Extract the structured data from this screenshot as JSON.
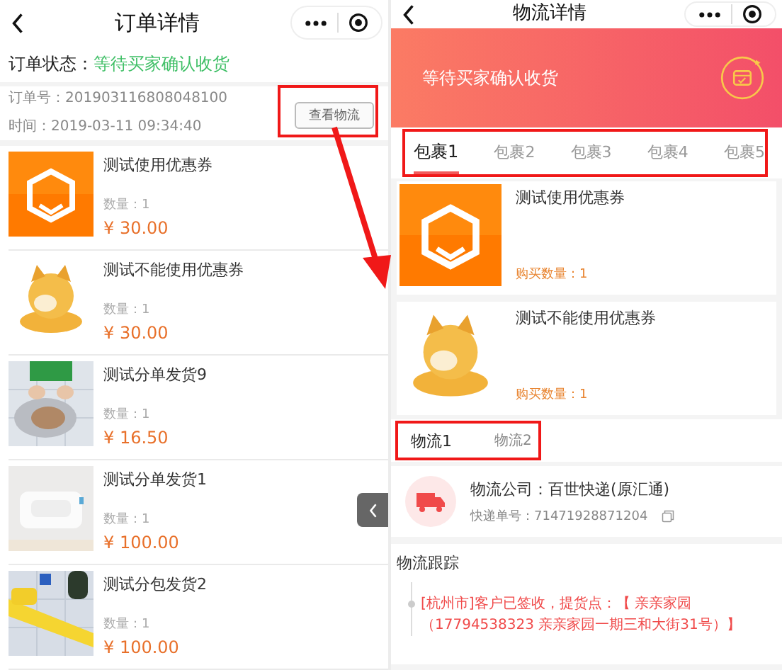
{
  "left_screen": {
    "title": "订单详情",
    "order_status": {
      "label": "订单状态：",
      "value": "等待买家确认收货"
    },
    "order_info": {
      "order_no": "订单号：201903116808048100",
      "time": "时间：2019-03-11 09:34:40",
      "button": {
        "label": "查看物流",
        "annotated": true
      }
    },
    "items": [
      {
        "name": "测试使用优惠券",
        "quantity": "数量：1",
        "price": "¥ 30.00"
      },
      {
        "name": "测试不能使用优惠券",
        "quantity": "数量：1",
        "price": "¥ 30.00"
      },
      {
        "name": "测试分单发货9",
        "quantity": "数量：1",
        "price": "¥ 16.50"
      },
      {
        "name": "测试分单发货1",
        "quantity": "数量：1",
        "price": "¥ 100.00"
      },
      {
        "name": "测试分包发货2",
        "quantity": "数量：1",
        "price": "¥ 100.00"
      }
    ]
  },
  "right_screen": {
    "title": "物流详情",
    "banner": "等待买家确认收货",
    "package_tabs": {
      "annotated": true,
      "tabs": [
        {
          "label": "包裹1",
          "selected": true
        },
        {
          "label": "包裹2",
          "selected": false
        },
        {
          "label": "包裹3",
          "selected": false
        },
        {
          "label": "包裹4",
          "selected": false
        },
        {
          "label": "包裹5",
          "selected": false
        }
      ]
    },
    "items": [
      {
        "name": "测试使用优惠券",
        "quantity": "购买数量：1"
      },
      {
        "name": "测试不能使用优惠券",
        "quantity": "购买数量：1"
      }
    ],
    "logistics_tabs": {
      "annotated": true,
      "tabs": [
        {
          "label": "物流1",
          "selected": true
        },
        {
          "label": "物流2",
          "selected": false
        }
      ]
    },
    "carrier": {
      "company": "物流公司：百世快递(原汇通)",
      "tracking_no": "快递单号：71471928871204"
    },
    "tracking": {
      "title": "物流跟踪",
      "events": [
        {
          "text": "[杭州市]客户已签收，提货点：【 亲亲家园（17794538323 亲亲家园一期三和大街31号）】"
        }
      ]
    }
  }
}
